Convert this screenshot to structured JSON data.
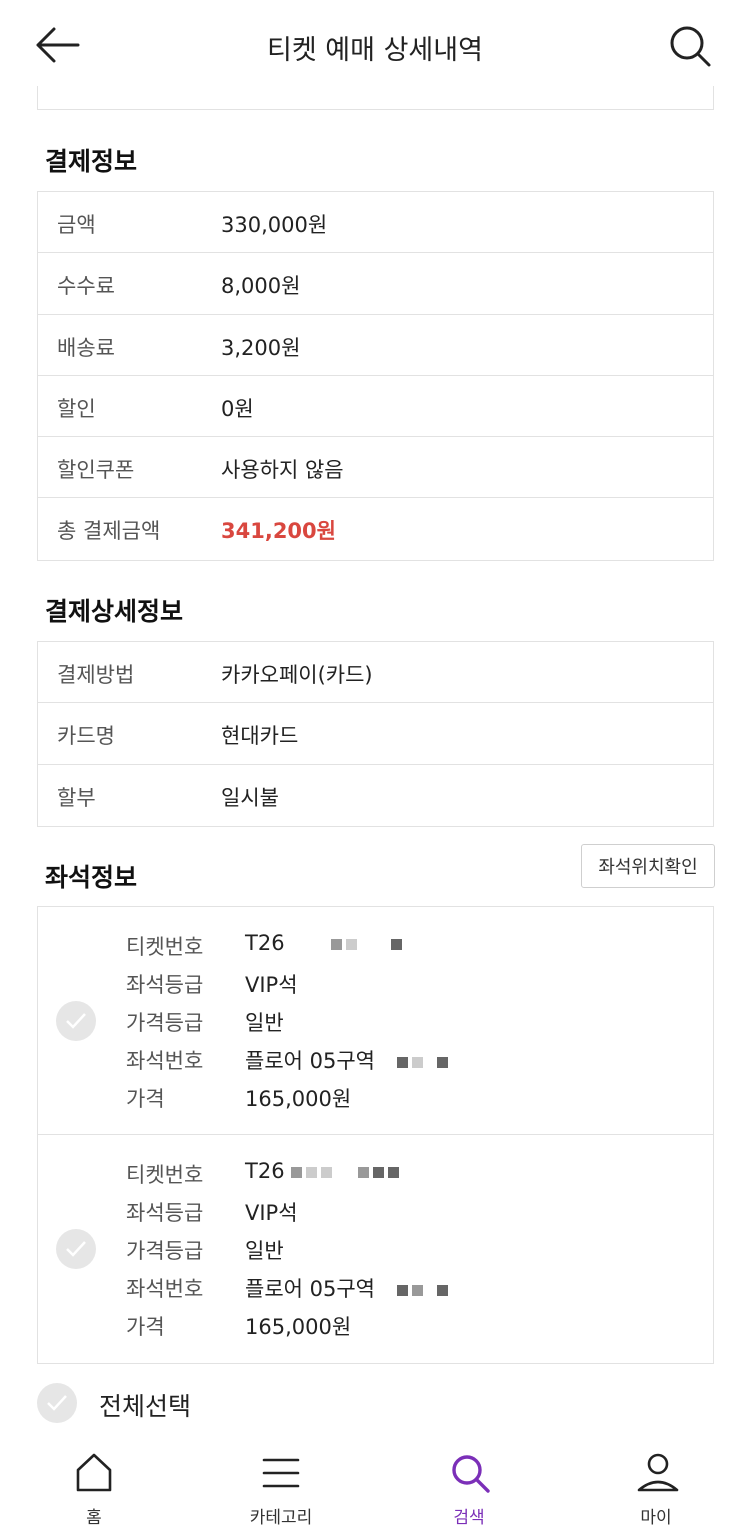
{
  "header": {
    "title": "티켓 예매 상세내역"
  },
  "payment": {
    "title": "결제정보",
    "rows": [
      {
        "label": "금액",
        "value": "330,000원"
      },
      {
        "label": "수수료",
        "value": "8,000원"
      },
      {
        "label": "배송료",
        "value": "3,200원"
      },
      {
        "label": "할인",
        "value": "0원"
      },
      {
        "label": "할인쿠폰",
        "value": "사용하지 않음"
      },
      {
        "label": "총 결제금액",
        "value": "341,200원"
      }
    ]
  },
  "payment_detail": {
    "title": "결제상세정보",
    "rows": [
      {
        "label": "결제방법",
        "value": "카카오페이(카드)"
      },
      {
        "label": "카드명",
        "value": "현대카드"
      },
      {
        "label": "할부",
        "value": "일시불"
      }
    ]
  },
  "seat": {
    "title": "좌석정보",
    "location_button": "좌석위치확인",
    "tickets": [
      {
        "ticket_no_label": "티켓번호",
        "ticket_no": "T26",
        "grade_label": "좌석등급",
        "grade": "VIP석",
        "price_grade_label": "가격등급",
        "price_grade": "일반",
        "seat_no_label": "좌석번호",
        "seat_no": "플로어 05구역",
        "price_label": "가격",
        "price": "165,000원"
      },
      {
        "ticket_no_label": "티켓번호",
        "ticket_no": "T26",
        "grade_label": "좌석등급",
        "grade": "VIP석",
        "price_grade_label": "가격등급",
        "price_grade": "일반",
        "seat_no_label": "좌석번호",
        "seat_no": "플로어 05구역",
        "price_label": "가격",
        "price": "165,000원"
      }
    ],
    "select_all": "전체선택"
  },
  "tabbar": {
    "items": [
      {
        "label": "홈",
        "icon": "home-icon"
      },
      {
        "label": "카테고리",
        "icon": "menu-icon"
      },
      {
        "label": "검색",
        "icon": "search-icon",
        "active": true
      },
      {
        "label": "마이",
        "icon": "user-icon"
      }
    ]
  },
  "colors": {
    "accent": "#7b2fb8",
    "total": "#d9473f"
  }
}
